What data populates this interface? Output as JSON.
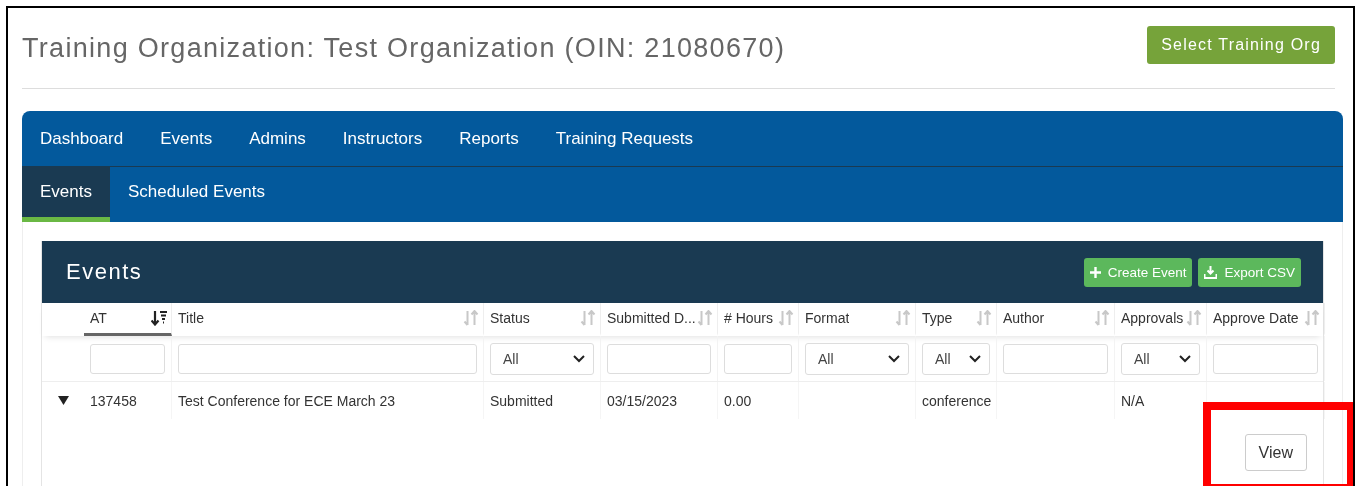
{
  "page_title": "Training Organization: Test Organization (OIN: 21080670)",
  "select_button": "Select Training Org",
  "nav": [
    {
      "label": "Dashboard",
      "selected": false
    },
    {
      "label": "Events",
      "selected": false
    },
    {
      "label": "Admins",
      "selected": false
    },
    {
      "label": "Instructors",
      "selected": false
    },
    {
      "label": "Reports",
      "selected": false
    },
    {
      "label": "Training Requests",
      "selected": false
    }
  ],
  "subnav": [
    {
      "label": "Events",
      "selected": true
    },
    {
      "label": "Scheduled Events",
      "selected": false
    }
  ],
  "panel": {
    "title": "Events",
    "actions": [
      {
        "label": "Create Event",
        "kind": "plus"
      },
      {
        "label": "Export CSV",
        "kind": "download"
      }
    ]
  },
  "table": {
    "columns": [
      {
        "label": "AT",
        "sorted": true,
        "filter": {
          "kind": "text"
        }
      },
      {
        "label": "Title",
        "sorted": false,
        "filter": {
          "kind": "text"
        }
      },
      {
        "label": "Status",
        "sorted": false,
        "filter": {
          "kind": "select",
          "value": "All"
        }
      },
      {
        "label": "Submitted D...",
        "sorted": false,
        "filter": {
          "kind": "text"
        }
      },
      {
        "label": "# Hours",
        "sorted": false,
        "filter": {
          "kind": "text"
        }
      },
      {
        "label": "Format",
        "sorted": false,
        "filter": {
          "kind": "select",
          "value": "All"
        }
      },
      {
        "label": "Type",
        "sorted": false,
        "filter": {
          "kind": "select",
          "value": "All"
        }
      },
      {
        "label": "Author",
        "sorted": false,
        "filter": {
          "kind": "text"
        }
      },
      {
        "label": "Approvals",
        "sorted": false,
        "filter": {
          "kind": "select",
          "value": "All"
        }
      },
      {
        "label": "Approve Date",
        "sorted": false,
        "filter": {
          "kind": "text"
        }
      }
    ],
    "rows": [
      {
        "expanded": true,
        "cells": [
          "137458",
          "Test Conference for ECE March 23",
          "Submitted",
          "03/15/2023",
          "0.00",
          "",
          "conference",
          "",
          "N/A",
          ""
        ],
        "actions": [
          "View"
        ]
      }
    ]
  }
}
